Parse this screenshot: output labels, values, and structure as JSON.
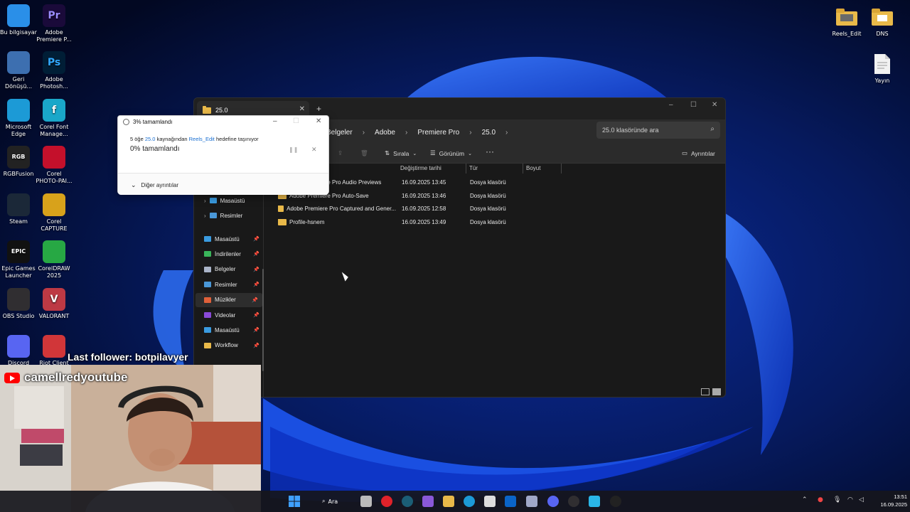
{
  "desktop": {
    "left_icons": [
      {
        "label": "Bu bilgisayar",
        "icon": "computer-icon",
        "color": "#2a8fe8"
      },
      {
        "label": "Adobe Premiere P...",
        "icon": "premiere-icon",
        "color": "#1a0a3a",
        "glyph": "Pr"
      },
      {
        "label": "Geri Dönüşü...",
        "icon": "recycle-bin-icon",
        "color": "#3d6fb0"
      },
      {
        "label": "Adobe Photosh...",
        "icon": "photoshop-icon",
        "color": "#001e36",
        "glyph": "Ps"
      },
      {
        "label": "Microsoft Edge",
        "icon": "edge-icon",
        "color": "#1c9ad6"
      },
      {
        "label": "Corel Font Manage...",
        "icon": "corel-font-icon",
        "color": "#1aa7c9",
        "glyph": "f"
      },
      {
        "label": "RGBFusion",
        "icon": "rgbfusion-icon",
        "color": "#222222",
        "glyph": "RGB"
      },
      {
        "label": "Corel PHOTO-PAI...",
        "icon": "corel-photo-icon",
        "color": "#c4102b"
      },
      {
        "label": "Steam",
        "icon": "steam-icon",
        "color": "#1b2838"
      },
      {
        "label": "Corel CAPTURE",
        "icon": "corel-capture-icon",
        "color": "#d8a21b"
      },
      {
        "label": "Epic Games Launcher",
        "icon": "epic-games-icon",
        "color": "#111111",
        "glyph": "EPIC"
      },
      {
        "label": "CorelDRAW 2025",
        "icon": "coreldraw-icon",
        "color": "#27a844"
      },
      {
        "label": "OBS Studio",
        "icon": "obs-icon",
        "color": "#302e31"
      },
      {
        "label": "VALORANT",
        "icon": "valorant-icon",
        "color": "#bd3944",
        "glyph": "V"
      },
      {
        "label": "Discord",
        "icon": "discord-icon",
        "color": "#5865f2"
      },
      {
        "label": "Riot Client",
        "icon": "riot-icon",
        "color": "#d13639"
      }
    ],
    "right_icons": [
      {
        "label": "Reels_Edit",
        "icon": "folder-icon"
      },
      {
        "label": "DNS",
        "icon": "folder-icon"
      },
      {
        "label": "Yayın",
        "icon": "text-file-icon"
      }
    ]
  },
  "explorer": {
    "tab_title": "25.0",
    "breadcrumb": [
      "Belgeler",
      "Adobe",
      "Premiere Pro",
      "25.0"
    ],
    "search_placeholder": "25.0 klasöründe ara",
    "toolbar": {
      "sort": "Sırala",
      "view": "Görünüm",
      "details": "Ayrıntılar"
    },
    "columns": {
      "date": "Değiştirme tarihi",
      "type": "Tür",
      "size": "Boyut"
    },
    "files": [
      {
        "name": "Adobe Premiere Pro Audio Previews",
        "date": "16.09.2025 13:45",
        "type": "Dosya klasörü"
      },
      {
        "name": "Adobe Premiere Pro Auto-Save",
        "date": "16.09.2025 13:46",
        "type": "Dosya klasörü"
      },
      {
        "name": "Adobe Premiere Pro Captured and Gener...",
        "date": "16.09.2025 12:58",
        "type": "Dosya klasörü"
      },
      {
        "name": "Profile-hsnem",
        "date": "16.09.2025 13:49",
        "type": "Dosya klasörü"
      }
    ],
    "nav_tree": [
      {
        "label": "Masaüstü"
      },
      {
        "label": "Resimler"
      }
    ],
    "nav_quick": [
      {
        "label": "Masaüstü",
        "color": "#3a9be0"
      },
      {
        "label": "İndirilenler",
        "color": "#3ab55a"
      },
      {
        "label": "Belgeler",
        "color": "#aab4c8"
      },
      {
        "label": "Resimler",
        "color": "#4a98d8"
      },
      {
        "label": "Müzikler",
        "color": "#e0603a"
      },
      {
        "label": "Videolar",
        "color": "#8a4ad8"
      },
      {
        "label": "Masaüstü",
        "color": "#3a9be0"
      },
      {
        "label": "Workflow",
        "color": "#e9b949"
      }
    ]
  },
  "progress_dialog": {
    "title": "3% tamamlandı",
    "count_text": "5 öğe",
    "source": "25.0",
    "source_suffix": "kaynağından",
    "dest": "Reels_Edit",
    "dest_suffix": "hedefine taşınıyor",
    "percent_text": "0% tamamlandı",
    "details_label": "Diğer ayrıntılar"
  },
  "overlay": {
    "follower": "Last follower: botpilavyer",
    "channel": "camellredyoutube"
  },
  "taskbar": {
    "search_label": "Ara",
    "time": "13:51",
    "date": "16.09.2025"
  }
}
